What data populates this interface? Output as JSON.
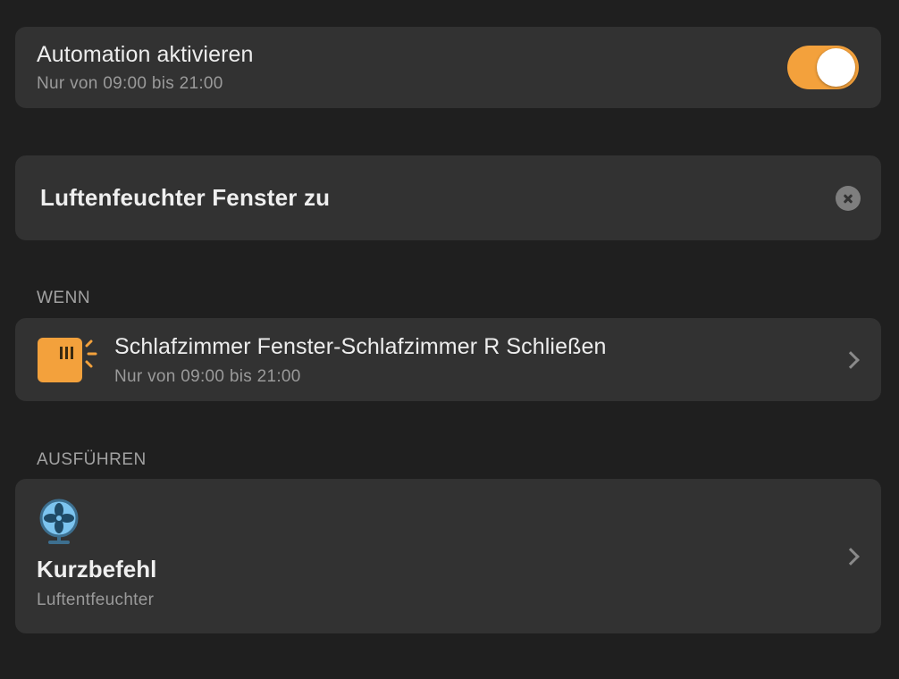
{
  "automation": {
    "label": "Automation aktivieren",
    "schedule": "Nur von 09:00 bis 21:00",
    "enabled": true
  },
  "name_field": {
    "value": "Luftenfeuchter Fenster zu"
  },
  "when_section": {
    "label": "WENN",
    "trigger": {
      "title": "Schlafzimmer Fenster-Schlafzimmer R Schließen",
      "schedule": "Nur von 09:00 bis 21:00",
      "icon": "window-icon"
    }
  },
  "execute_section": {
    "label": "AUSFÜHREN",
    "action": {
      "title": "Kurzbefehl",
      "subtitle": "Luftentfeuchter",
      "icon": "fan-icon"
    }
  },
  "colors": {
    "accent": "#f3a13c",
    "background": "#1f1f1f",
    "card": "#323232",
    "fan_blue": "#7cc4ef"
  }
}
